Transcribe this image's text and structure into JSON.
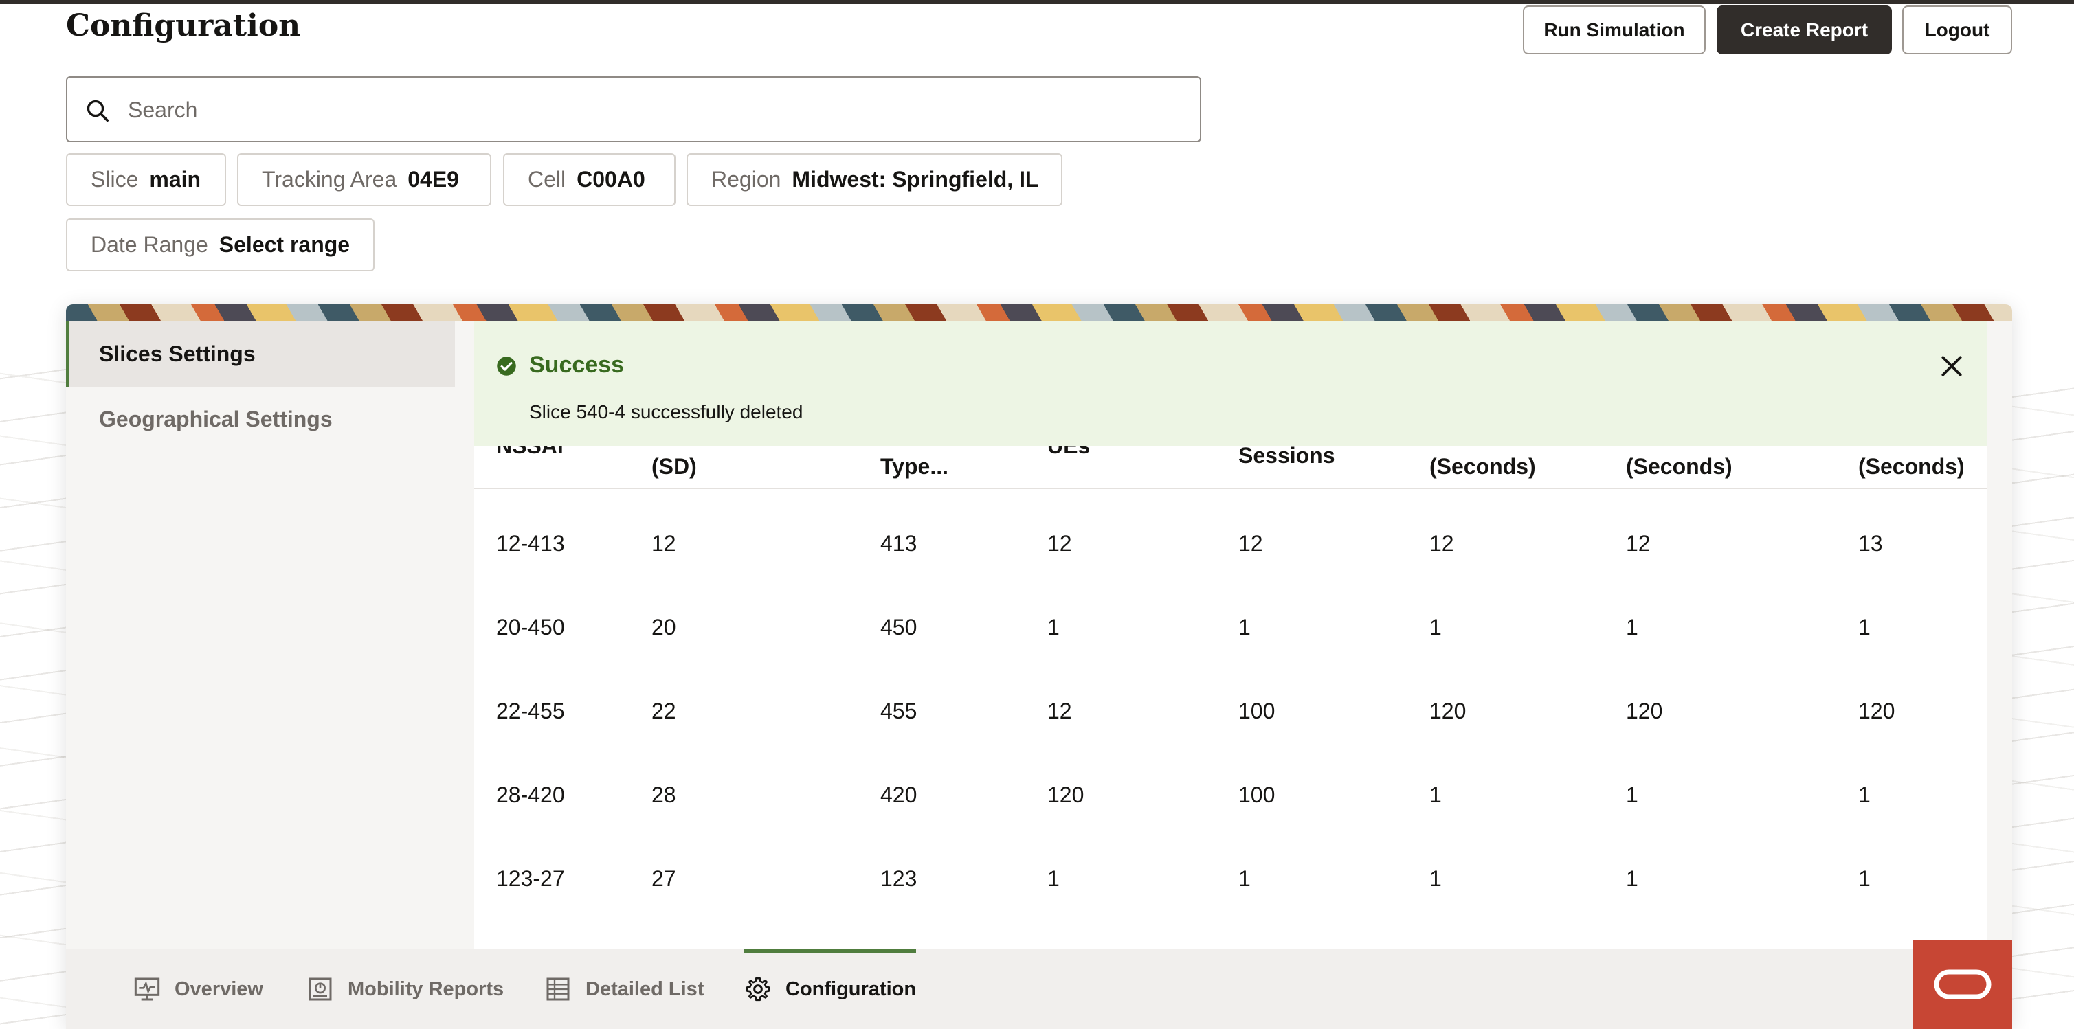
{
  "header": {
    "title": "Configuration",
    "buttons": {
      "run_simulation": "Run Simulation",
      "create_report": "Create Report",
      "logout": "Logout"
    }
  },
  "search": {
    "placeholder": "Search",
    "value": ""
  },
  "filters": [
    {
      "label": "Slice",
      "value": "main"
    },
    {
      "label": "Tracking Area",
      "value": "04E9"
    },
    {
      "label": "Cell",
      "value": "C00A0"
    },
    {
      "label": "Region",
      "value": "Midwest: Springfield, IL"
    },
    {
      "label": "Date Range",
      "value": "Select range"
    }
  ],
  "sidebar": {
    "items": [
      {
        "label": "Slices Settings",
        "active": true
      },
      {
        "label": "Geographical Settings",
        "active": false
      }
    ]
  },
  "alert": {
    "title": "Success",
    "message": "Slice 540-4 successfully deleted",
    "icon": "check-circle-icon",
    "close_icon": "close-icon"
  },
  "table": {
    "headers": [
      "NSSAI",
      "(SD)",
      "Type...",
      "UEs",
      "Sessions",
      "(Seconds)",
      "(Seconds)",
      "(Seconds)"
    ],
    "rows": [
      [
        "12-413",
        "12",
        "413",
        "12",
        "12",
        "12",
        "12",
        "13"
      ],
      [
        "20-450",
        "20",
        "450",
        "1",
        "1",
        "1",
        "1",
        "1"
      ],
      [
        "22-455",
        "22",
        "455",
        "12",
        "100",
        "120",
        "120",
        "120"
      ],
      [
        "28-420",
        "28",
        "420",
        "120",
        "100",
        "1",
        "1",
        "1"
      ],
      [
        "123-27",
        "27",
        "123",
        "1",
        "1",
        "1",
        "1",
        "1"
      ]
    ]
  },
  "bottom_nav": {
    "items": [
      {
        "label": "Overview",
        "icon": "monitor-pulse-icon",
        "active": false
      },
      {
        "label": "Mobility Reports",
        "icon": "report-icon",
        "active": false
      },
      {
        "label": "Detailed List",
        "icon": "list-icon",
        "active": false
      },
      {
        "label": "Configuration",
        "icon": "gear-icon",
        "active": true
      }
    ]
  },
  "colors": {
    "accent_green": "#507d3e",
    "success_bg": "#edf5e4",
    "success_text": "#386a1f",
    "dark_button": "#312d2a",
    "brand_red": "#c74634"
  }
}
